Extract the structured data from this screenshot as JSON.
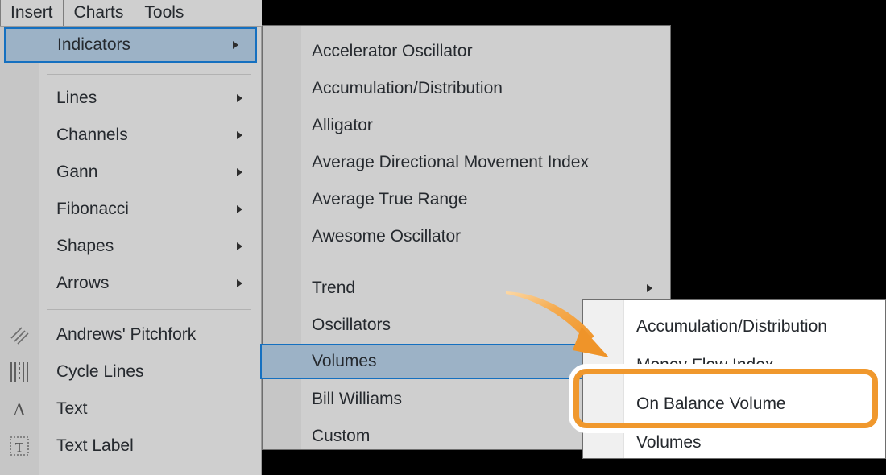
{
  "window": {
    "background_color": "#000000",
    "menu_background": "#cfcfcf",
    "highlight_fill": "#9cb2c6",
    "highlight_border": "#1570c0",
    "accent_color": "#f0982d"
  },
  "menubar": {
    "tabs": [
      {
        "label": "Insert",
        "active": true
      },
      {
        "label": "Charts",
        "active": false
      },
      {
        "label": "Tools",
        "active": false
      }
    ]
  },
  "insert_menu": {
    "items": [
      {
        "label": "Indicators",
        "has_submenu": true,
        "selected": true,
        "icon": "none"
      },
      {
        "label": "Lines",
        "has_submenu": true,
        "selected": false,
        "icon": "none"
      },
      {
        "label": "Channels",
        "has_submenu": true,
        "selected": false,
        "icon": "none"
      },
      {
        "label": "Gann",
        "has_submenu": true,
        "selected": false,
        "icon": "none"
      },
      {
        "label": "Fibonacci",
        "has_submenu": true,
        "selected": false,
        "icon": "none"
      },
      {
        "label": "Shapes",
        "has_submenu": true,
        "selected": false,
        "icon": "none"
      },
      {
        "label": "Arrows",
        "has_submenu": true,
        "selected": false,
        "icon": "none"
      },
      {
        "label": "Andrews' Pitchfork",
        "has_submenu": false,
        "selected": false,
        "icon": "pitchfork-icon"
      },
      {
        "label": "Cycle Lines",
        "has_submenu": false,
        "selected": false,
        "icon": "cycle-lines-icon"
      },
      {
        "label": "Text",
        "has_submenu": false,
        "selected": false,
        "icon": "text-a-icon"
      },
      {
        "label": "Text Label",
        "has_submenu": false,
        "selected": false,
        "icon": "text-label-icon"
      }
    ]
  },
  "indicators_menu": {
    "items": [
      {
        "label": "Accelerator Oscillator",
        "has_submenu": false,
        "selected": false
      },
      {
        "label": "Accumulation/Distribution",
        "has_submenu": false,
        "selected": false
      },
      {
        "label": "Alligator",
        "has_submenu": false,
        "selected": false
      },
      {
        "label": "Average Directional Movement Index",
        "has_submenu": false,
        "selected": false
      },
      {
        "label": "Average True Range",
        "has_submenu": false,
        "selected": false
      },
      {
        "label": "Awesome Oscillator",
        "has_submenu": false,
        "selected": false
      },
      {
        "label": "Trend",
        "has_submenu": true,
        "selected": false
      },
      {
        "label": "Oscillators",
        "has_submenu": true,
        "selected": false
      },
      {
        "label": "Volumes",
        "has_submenu": true,
        "selected": true
      },
      {
        "label": "Bill Williams",
        "has_submenu": false,
        "selected": false
      },
      {
        "label": "Custom",
        "has_submenu": false,
        "selected": false
      }
    ]
  },
  "volumes_menu": {
    "items": [
      {
        "label": "Accumulation/Distribution",
        "highlighted": false
      },
      {
        "label": "Money Flow Index",
        "highlighted": false
      },
      {
        "label": "On Balance Volume",
        "highlighted": true
      },
      {
        "label": "Volumes",
        "highlighted": false
      }
    ]
  },
  "annotation": {
    "arrow": "curved-arrow-pointing-to-volumes-submenu",
    "callout_target": "On Balance Volume"
  }
}
